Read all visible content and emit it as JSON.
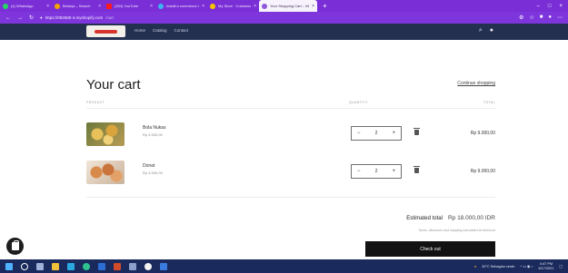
{
  "browser": {
    "tabs": [
      {
        "title": "(4) WhatsApp",
        "color": "#25d366"
      },
      {
        "title": "Belanja – Search",
        "color": "#f4a400"
      },
      {
        "title": "(334) YouTube",
        "color": "#ff1b1b"
      },
      {
        "title": "Install a commerce theme",
        "color": "#3bb4f2"
      },
      {
        "title": "My Store · Customize theme",
        "color": "#f7c600"
      },
      {
        "title": "Your Shopping Cart – My",
        "color": "#8f58d9",
        "active": true
      }
    ],
    "new_tab": "+",
    "url_host": "https://092580-4.myshopify.com",
    "url_path": "/cart"
  },
  "store": {
    "nav": [
      "Home",
      "Catalog",
      "Contact"
    ]
  },
  "cart": {
    "title": "Your cart",
    "continue": "Continue shopping",
    "headers": {
      "product": "PRODUCT",
      "quantity": "QUANTITY",
      "total": "TOTAL"
    },
    "items": [
      {
        "name": "Bola Nukas",
        "price": "Rp 4.500,00",
        "qty": "2",
        "total": "Rp 9.000,00"
      },
      {
        "name": "Donat",
        "price": "Rp 4.500,00",
        "qty": "2",
        "total": "Rp 9.000,00"
      }
    ],
    "estimated_label": "Estimated total",
    "estimated_value": "Rp 18.000,00 IDR",
    "taxes_note": "Taxes, discounts and shipping calculated at checkout",
    "checkout": "Check out"
  },
  "taskbar": {
    "weather": "30°C Sebagian cerah",
    "time": "4:47 PM",
    "date": "6/17/2021"
  }
}
